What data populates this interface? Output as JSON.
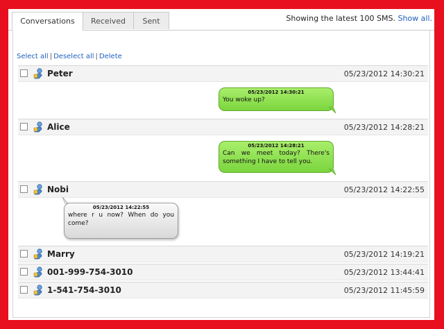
{
  "tabs": [
    {
      "label": "Conversations",
      "active": true
    },
    {
      "label": "Received",
      "active": false
    },
    {
      "label": "Sent",
      "active": false
    }
  ],
  "status": {
    "text": "Showing the latest 100 SMS.",
    "link": "Show all."
  },
  "actions": {
    "select_all": "Select all",
    "deselect_all": "Deselect all",
    "delete": "Delete"
  },
  "conversations": [
    {
      "name": "Peter",
      "time": "05/23/2012 14:30:21",
      "message": {
        "timestamp": "05/23/2012 14:30:21",
        "text": "You woke up?",
        "direction": "sent"
      }
    },
    {
      "name": "Alice",
      "time": "05/23/2012 14:28:21",
      "message": {
        "timestamp": "05/23/2012 14:28:21",
        "text": "Can we meet today? There's something I have to tell you.",
        "direction": "sent"
      }
    },
    {
      "name": "Nobi",
      "time": "05/23/2012 14:22:55",
      "message": {
        "timestamp": "05/23/2012 14:22:55",
        "text": "where r u now? When do you come?",
        "direction": "received"
      }
    },
    {
      "name": "Marry",
      "time": "05/23/2012 14:19:21"
    },
    {
      "name": "001-999-754-3010",
      "time": "05/23/2012 13:44:41"
    },
    {
      "name": "1-541-754-3010",
      "time": "05/23/2012 11:45:59"
    }
  ],
  "colors": {
    "frame": "#e8101e",
    "link": "#1f5fbf",
    "sent_bubble": "#8fe04f",
    "received_bubble": "#e6e6e6"
  },
  "icons": {
    "contact": "person-icon"
  }
}
